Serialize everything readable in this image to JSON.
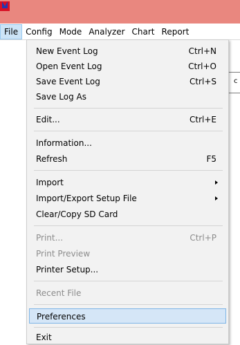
{
  "app": {
    "icon": "app-logo-icon"
  },
  "menubar": {
    "items": [
      {
        "label": "File"
      },
      {
        "label": "Config"
      },
      {
        "label": "Mode"
      },
      {
        "label": "Analyzer"
      },
      {
        "label": "Chart"
      },
      {
        "label": "Report"
      }
    ]
  },
  "background": {
    "fragment": "c"
  },
  "file_menu": {
    "new_event_log": {
      "label": "New Event Log",
      "shortcut": "Ctrl+N"
    },
    "open_event_log": {
      "label": "Open Event Log",
      "shortcut": "Ctrl+O"
    },
    "save_event_log": {
      "label": "Save Event Log",
      "shortcut": "Ctrl+S"
    },
    "save_log_as": {
      "label": "Save Log As"
    },
    "edit": {
      "label": "Edit...",
      "shortcut": "Ctrl+E"
    },
    "information": {
      "label": "Information..."
    },
    "refresh": {
      "label": "Refresh",
      "shortcut": "F5"
    },
    "import": {
      "label": "Import",
      "submenu_icon": "chevron-right-icon"
    },
    "import_export_setup": {
      "label": "Import/Export Setup File",
      "submenu_icon": "chevron-right-icon"
    },
    "clear_copy_sd": {
      "label": "Clear/Copy SD Card"
    },
    "print": {
      "label": "Print...",
      "shortcut": "Ctrl+P",
      "disabled": true
    },
    "print_preview": {
      "label": "Print Preview",
      "disabled": true
    },
    "printer_setup": {
      "label": "Printer Setup..."
    },
    "recent_file": {
      "label": "Recent File",
      "disabled": true
    },
    "preferences": {
      "label": "Preferences",
      "highlighted": true
    },
    "exit": {
      "label": "Exit"
    }
  },
  "colors": {
    "titlebar": "#e9877f",
    "menu_background": "#f2f2f2",
    "highlight": "#d5e6f7",
    "highlight_border": "#7fb5e6",
    "disabled_text": "#8c8c8c"
  }
}
